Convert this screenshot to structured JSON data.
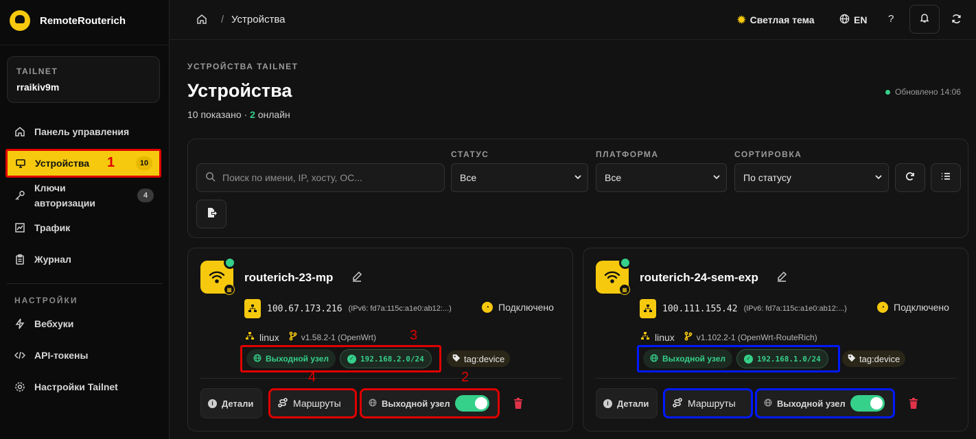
{
  "brand": {
    "name": "RemoteRouterich"
  },
  "tailnet": {
    "label": "TAILNET",
    "name": "rraikiv9m"
  },
  "nav": {
    "dashboard": "Панель управления",
    "devices": "Устройства",
    "devices_count": "10",
    "keys": "Ключи авторизации",
    "keys_count": "4",
    "traffic": "Трафик",
    "journal": "Журнал",
    "settings_section": "НАСТРОЙКИ",
    "webhooks": "Вебхуки",
    "api_tokens": "API-токены",
    "tailnet_settings": "Настройки Tailnet"
  },
  "annotations": {
    "a1": "1",
    "a2": "2",
    "a3": "3",
    "a4": "4"
  },
  "topbar": {
    "breadcrumb_sep": "/",
    "breadcrumb": "Устройства",
    "theme": "Светлая тема",
    "lang": "EN",
    "help": "?"
  },
  "page": {
    "eyebrow": "УСТРОЙСТВА TAILNET",
    "title": "Устройства",
    "shown": "10 показано · ",
    "online_count": "2",
    "online_label": " онлайн",
    "updated": "Обновлено 14:06"
  },
  "filters": {
    "search_placeholder": "Поиск по имени, IP, хосту, ОС...",
    "status_label": "СТАТУС",
    "status_value": "Все",
    "platform_label": "ПЛАТФОРМА",
    "platform_value": "Все",
    "sort_label": "СОРТИРОВКА",
    "sort_value": "По статусу"
  },
  "devices": [
    {
      "name": "routerich-23-mp",
      "ip": "100.67.173.216",
      "ipv6": "(IPv6: fd7a:115c:a1e0:ab12:...)",
      "status": "Подключено",
      "os": "linux",
      "version": "v1.58.2-1 (OpenWrt)",
      "exit_tag": "Выходной узел",
      "route": "192.168.2.0/24",
      "tag": "tag:device",
      "details": "Детали",
      "routes": "Маршруты",
      "exit_btn": "Выходной узел"
    },
    {
      "name": "routerich-24-sem-exp",
      "ip": "100.111.155.42",
      "ipv6": "(IPv6: fd7a:115c:a1e0:ab12:...)",
      "status": "Подключено",
      "os": "linux",
      "version": "v1.102.2-1 (OpenWrt-RouteRich)",
      "exit_tag": "Выходной узел",
      "route": "192.168.1.0/24",
      "tag": "tag:device",
      "details": "Детали",
      "routes": "Маршруты",
      "exit_btn": "Выходной узел"
    }
  ],
  "colors": {
    "accent": "#f6c90e",
    "online": "#35d08a",
    "danger": "#e0334a",
    "annotation_red": "#e00000",
    "annotation_blue": "#0019ff"
  }
}
